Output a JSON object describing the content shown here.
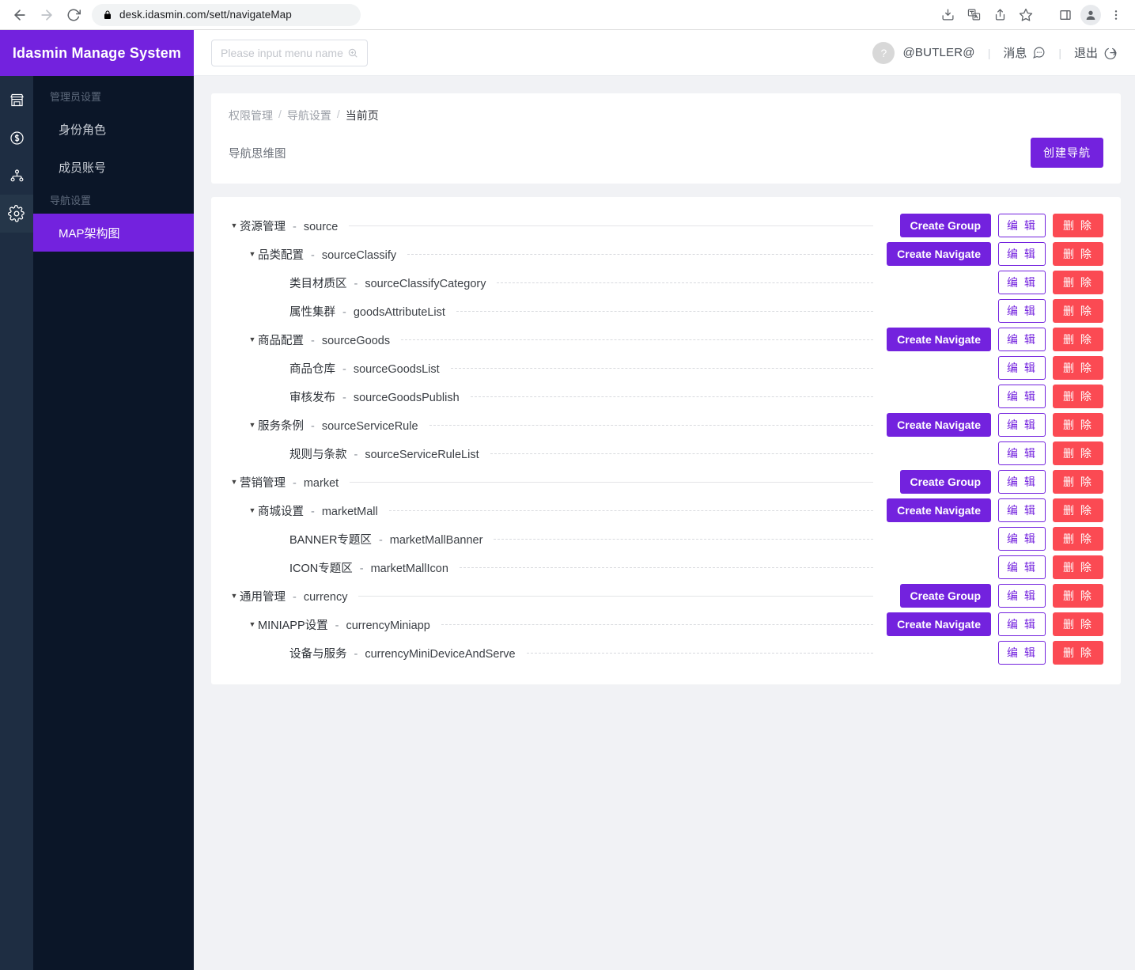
{
  "browser": {
    "url": "desk.idasmin.com/sett/navigateMap",
    "back_icon": "back-arrow-icon",
    "forward_icon": "forward-arrow-icon",
    "reload_icon": "reload-icon",
    "lock_icon": "lock-icon",
    "toolbar_icons": [
      "install-icon",
      "translate-icon",
      "share-icon",
      "bookmark-star-icon",
      "side-panel-icon",
      "profile-avatar-icon",
      "more-menu-icon"
    ]
  },
  "app": {
    "logo_title": "Idasmin Manage System",
    "brand_purple": "#7322DE",
    "danger_red": "#FB4A53",
    "search": {
      "placeholder": "Please input menu name",
      "value": "",
      "icon": "search-zoom-icon"
    },
    "user": {
      "avatar_text": "?",
      "name": "@BUTLER@",
      "divider": "|",
      "messages_label": "消息",
      "messages_icon": "chat-bubble-icon",
      "logout_label": "退出",
      "logout_icon": "logout-arrow-icon"
    }
  },
  "sidebar": {
    "rail": [
      {
        "name": "store-icon",
        "active": false
      },
      {
        "name": "dollar-circle-icon",
        "active": false
      },
      {
        "name": "org-chart-icon",
        "active": false
      },
      {
        "name": "gear-icon",
        "active": true
      }
    ],
    "groups": [
      {
        "title": "管理员设置",
        "items": [
          {
            "label": "身份角色",
            "active": false
          },
          {
            "label": "成员账号",
            "active": false
          }
        ]
      },
      {
        "title": "导航设置",
        "items": [
          {
            "label": "MAP架构图",
            "active": true
          }
        ]
      }
    ]
  },
  "main": {
    "breadcrumb": [
      "权限管理",
      "导航设置",
      "当前页"
    ],
    "breadcrumb_separator": "/",
    "page_title": "导航思维图",
    "create_button": "创建导航",
    "labels": {
      "create_group": "Create Group",
      "create_navigate": "Create Navigate",
      "edit": "编 辑",
      "delete": "删 除",
      "dash": "-",
      "caret": "▼"
    },
    "tree": [
      {
        "level": 1,
        "label": "资源管理",
        "code": "source",
        "caret": true,
        "create": "Create Group"
      },
      {
        "level": 2,
        "label": "品类配置",
        "code": "sourceClassify",
        "caret": true,
        "create": "Create Navigate"
      },
      {
        "level": 3,
        "label": "类目材质区",
        "code": "sourceClassifyCategory",
        "caret": false,
        "create": null
      },
      {
        "level": 3,
        "label": "属性集群",
        "code": "goodsAttributeList",
        "caret": false,
        "create": null
      },
      {
        "level": 2,
        "label": "商品配置",
        "code": "sourceGoods",
        "caret": true,
        "create": "Create Navigate"
      },
      {
        "level": 3,
        "label": "商品仓库",
        "code": "sourceGoodsList",
        "caret": false,
        "create": null
      },
      {
        "level": 3,
        "label": "审核发布",
        "code": "sourceGoodsPublish",
        "caret": false,
        "create": null
      },
      {
        "level": 2,
        "label": "服务条例",
        "code": "sourceServiceRule",
        "caret": true,
        "create": "Create Navigate"
      },
      {
        "level": 3,
        "label": "规则与条款",
        "code": "sourceServiceRuleList",
        "caret": false,
        "create": null
      },
      {
        "level": 1,
        "label": "营销管理",
        "code": "market",
        "caret": true,
        "create": "Create Group"
      },
      {
        "level": 2,
        "label": "商城设置",
        "code": "marketMall",
        "caret": true,
        "create": "Create Navigate"
      },
      {
        "level": 3,
        "label": "BANNER专题区",
        "code": "marketMallBanner",
        "caret": false,
        "create": null
      },
      {
        "level": 3,
        "label": "ICON专题区",
        "code": "marketMallIcon",
        "caret": false,
        "create": null
      },
      {
        "level": 1,
        "label": "通用管理",
        "code": "currency",
        "caret": true,
        "create": "Create Group"
      },
      {
        "level": 2,
        "label": "MINIAPP设置",
        "code": "currencyMiniapp",
        "caret": true,
        "create": "Create Navigate"
      },
      {
        "level": 3,
        "label": "设备与服务",
        "code": "currencyMiniDeviceAndServe",
        "caret": false,
        "create": null
      }
    ]
  }
}
